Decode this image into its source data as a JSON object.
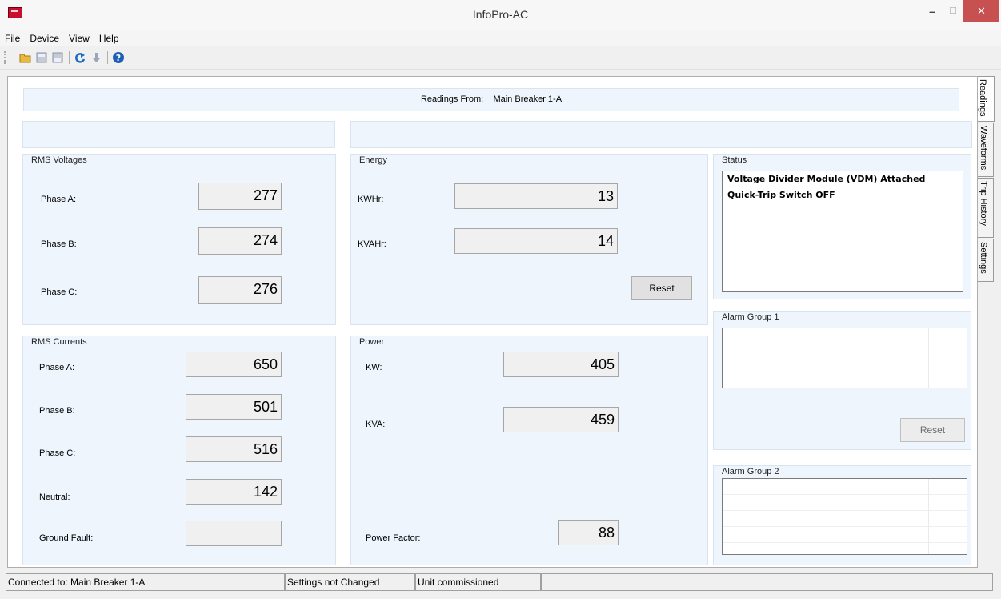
{
  "window": {
    "title": "InfoPro-AC",
    "close_glyph": "✕",
    "min_glyph": "–",
    "max_glyph": "☐"
  },
  "menu": [
    "File",
    "Device",
    "View",
    "Help"
  ],
  "toolbar": {
    "icons": [
      "open-folder-icon",
      "save-icon",
      "save-as-icon",
      "refresh-icon",
      "download-icon",
      "help-icon"
    ]
  },
  "tabs": [
    "Readings",
    "Waveforms",
    "Trip History",
    "Settings"
  ],
  "readings_from": {
    "label": "Readings From:",
    "device": "Main Breaker 1-A"
  },
  "rms_voltages": {
    "title": "RMS Voltages",
    "rows": [
      {
        "label": "Phase A:",
        "value": "277"
      },
      {
        "label": "Phase B:",
        "value": "274"
      },
      {
        "label": "Phase C:",
        "value": "276"
      }
    ]
  },
  "energy": {
    "title": "Energy",
    "rows": [
      {
        "label": "KWHr:",
        "value": "13"
      },
      {
        "label": "KVAHr:",
        "value": "14"
      }
    ],
    "reset_label": "Reset"
  },
  "status": {
    "title": "Status",
    "lines": [
      "Voltage Divider Module (VDM) Attached",
      "Quick-Trip Switch OFF"
    ]
  },
  "rms_currents": {
    "title": "RMS Currents",
    "rows": [
      {
        "label": "Phase A:",
        "value": "650"
      },
      {
        "label": "Phase B:",
        "value": "501"
      },
      {
        "label": "Phase C:",
        "value": "516"
      },
      {
        "label": "Neutral:",
        "value": "142"
      },
      {
        "label": "Ground Fault:",
        "value": ""
      }
    ]
  },
  "power": {
    "title": "Power",
    "kw": {
      "label": "KW:",
      "value": "405"
    },
    "kva": {
      "label": "KVA:",
      "value": "459"
    },
    "pf": {
      "label": "Power Factor:",
      "value": "88"
    }
  },
  "alarm1": {
    "title": "Alarm Group 1",
    "reset_label": "Reset"
  },
  "alarm2": {
    "title": "Alarm Group 2"
  },
  "statusbar": {
    "connected": "Connected to: Main Breaker 1-A",
    "settings": "Settings not Changed",
    "unit": "Unit commissioned"
  }
}
